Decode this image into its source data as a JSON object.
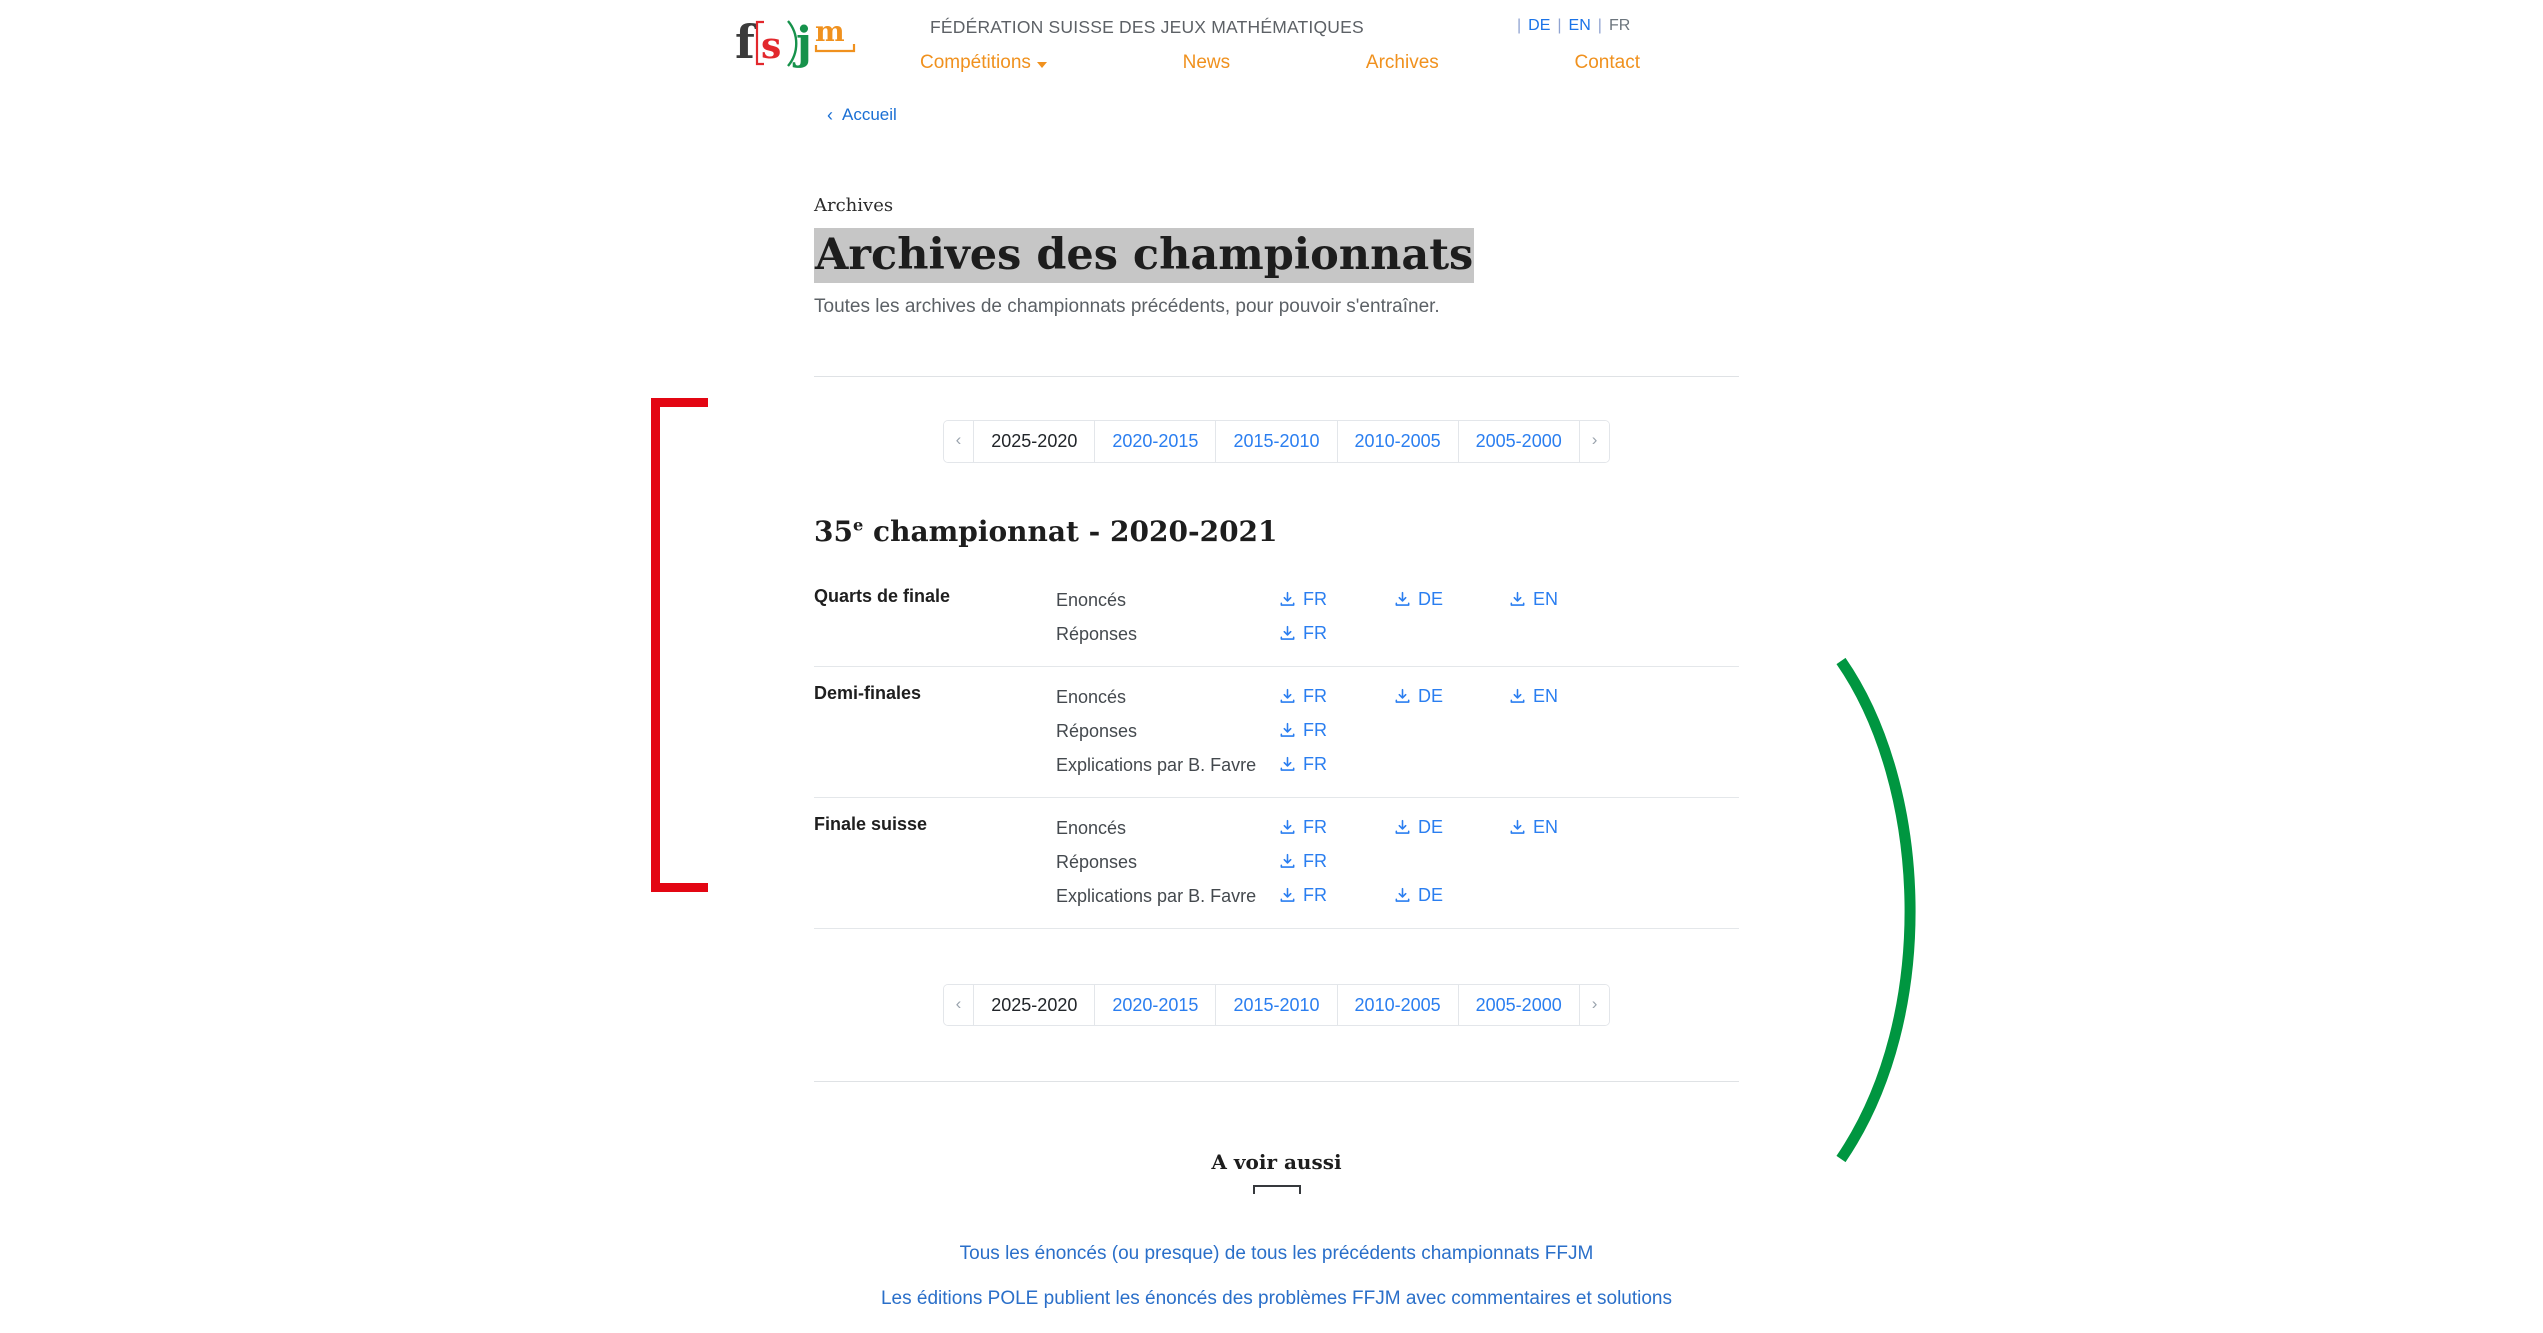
{
  "header": {
    "logo_alt": "f[s)j m",
    "tagline": "FÉDÉRATION SUISSE DES JEUX MATHÉMATIQUES",
    "languages": [
      {
        "code": "DE",
        "active": false
      },
      {
        "code": "EN",
        "active": false
      },
      {
        "code": "FR",
        "active": true
      }
    ],
    "separator": "|",
    "nav": [
      {
        "label": "Compétitions",
        "has_dropdown": true
      },
      {
        "label": "News",
        "has_dropdown": false
      },
      {
        "label": "Archives",
        "has_dropdown": false
      },
      {
        "label": "Contact",
        "has_dropdown": false
      }
    ]
  },
  "breadcrumb": {
    "chevron": "‹",
    "label": "Accueil"
  },
  "page": {
    "eyebrow": "Archives",
    "title": "Archives des championnats",
    "subtitle": "Toutes les archives de championnats précédents, pour pouvoir s'entraîner."
  },
  "pagination": {
    "prev": "‹",
    "next": "›",
    "items": [
      {
        "label": "2025-2020",
        "active": true
      },
      {
        "label": "2020-2015",
        "active": false
      },
      {
        "label": "2015-2010",
        "active": false
      },
      {
        "label": "2010-2005",
        "active": false
      },
      {
        "label": "2005-2000",
        "active": false
      }
    ]
  },
  "championship": {
    "number": "35",
    "ordinal_suffix": "e",
    "title_rest": " championnat - 2020-2021",
    "rounds": [
      {
        "name": "Quarts de finale",
        "rows": [
          {
            "label": "Enoncés",
            "downloads": [
              "FR",
              "DE",
              "EN"
            ]
          },
          {
            "label": "Réponses",
            "downloads": [
              "FR"
            ]
          }
        ]
      },
      {
        "name": "Demi-finales",
        "rows": [
          {
            "label": "Enoncés",
            "downloads": [
              "FR",
              "DE",
              "EN"
            ]
          },
          {
            "label": "Réponses",
            "downloads": [
              "FR"
            ]
          },
          {
            "label": "Explications par B. Favre",
            "downloads": [
              "FR"
            ]
          }
        ]
      },
      {
        "name": "Finale suisse",
        "rows": [
          {
            "label": "Enoncés",
            "downloads": [
              "FR",
              "DE",
              "EN"
            ]
          },
          {
            "label": "Réponses",
            "downloads": [
              "FR"
            ]
          },
          {
            "label": "Explications par B. Favre",
            "downloads": [
              "FR",
              "DE"
            ]
          }
        ]
      }
    ]
  },
  "also": {
    "title": "A voir aussi",
    "links": [
      "Tous les énoncés (ou presque) de tous les précédents championnats FFJM",
      "Les éditions POLE publient les énoncés des problèmes FFJM avec commentaires et solutions"
    ]
  },
  "colors": {
    "brand_orange": "#f0911e",
    "link_blue": "#2a7ef0",
    "deco_red": "#e30613",
    "deco_green": "#009640",
    "logo_red": "#e2282d",
    "logo_green": "#16924b",
    "logo_dark": "#3b3b3b",
    "highlight_gray": "#c6c6c6"
  },
  "icons": {
    "download": "download-icon",
    "chevron_left": "chevron-left-icon",
    "chevron_right": "chevron-right-icon",
    "caret_down": "chevron-down-icon"
  }
}
